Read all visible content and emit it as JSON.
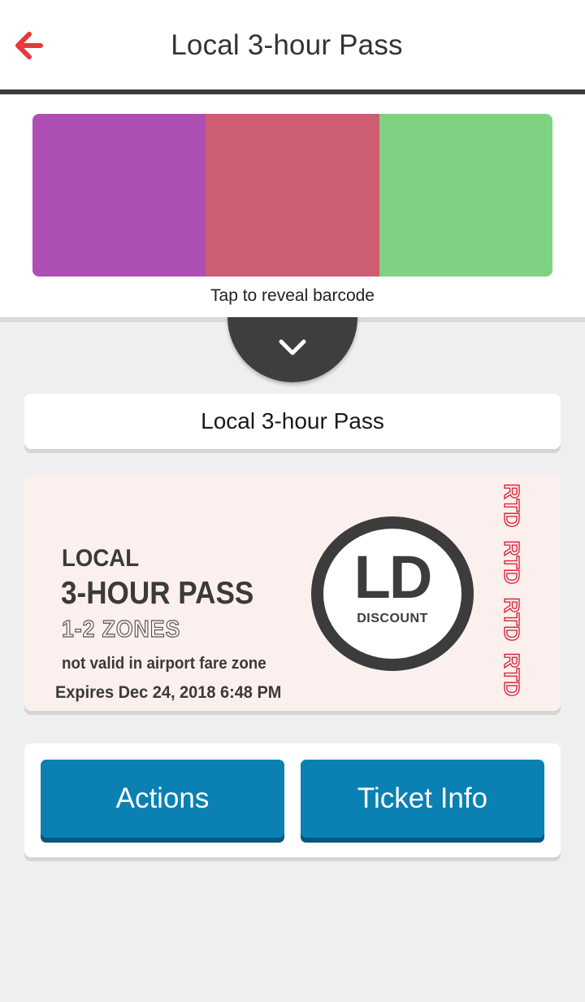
{
  "header": {
    "title": "Local 3-hour Pass",
    "back_icon": "arrow-left-icon",
    "accent_color": "#e8383b"
  },
  "barcode": {
    "colors": [
      "#ad4fb4",
      "#cd5d72",
      "#80d283"
    ],
    "reveal_label": "Tap to reveal barcode",
    "toggle_icon": "chevron-down-icon"
  },
  "pass_name": "Local 3-hour Pass",
  "ticket": {
    "line1": "LOCAL",
    "line2": "3-HOUR PASS",
    "zones": "1-2 ZONES",
    "restriction": "not valid in airport fare zone",
    "expires": "Expires Dec 24, 2018 6:48 PM",
    "badge": {
      "code": "LD",
      "label": "DISCOUNT"
    },
    "watermark": [
      "RTD",
      "RTD",
      "RTD",
      "RTD"
    ],
    "background_color": "#fbf0ee",
    "watermark_color": "#d8283c"
  },
  "actions": {
    "primary_label": "Actions",
    "secondary_label": "Ticket Info",
    "button_color": "#0a80b3"
  }
}
